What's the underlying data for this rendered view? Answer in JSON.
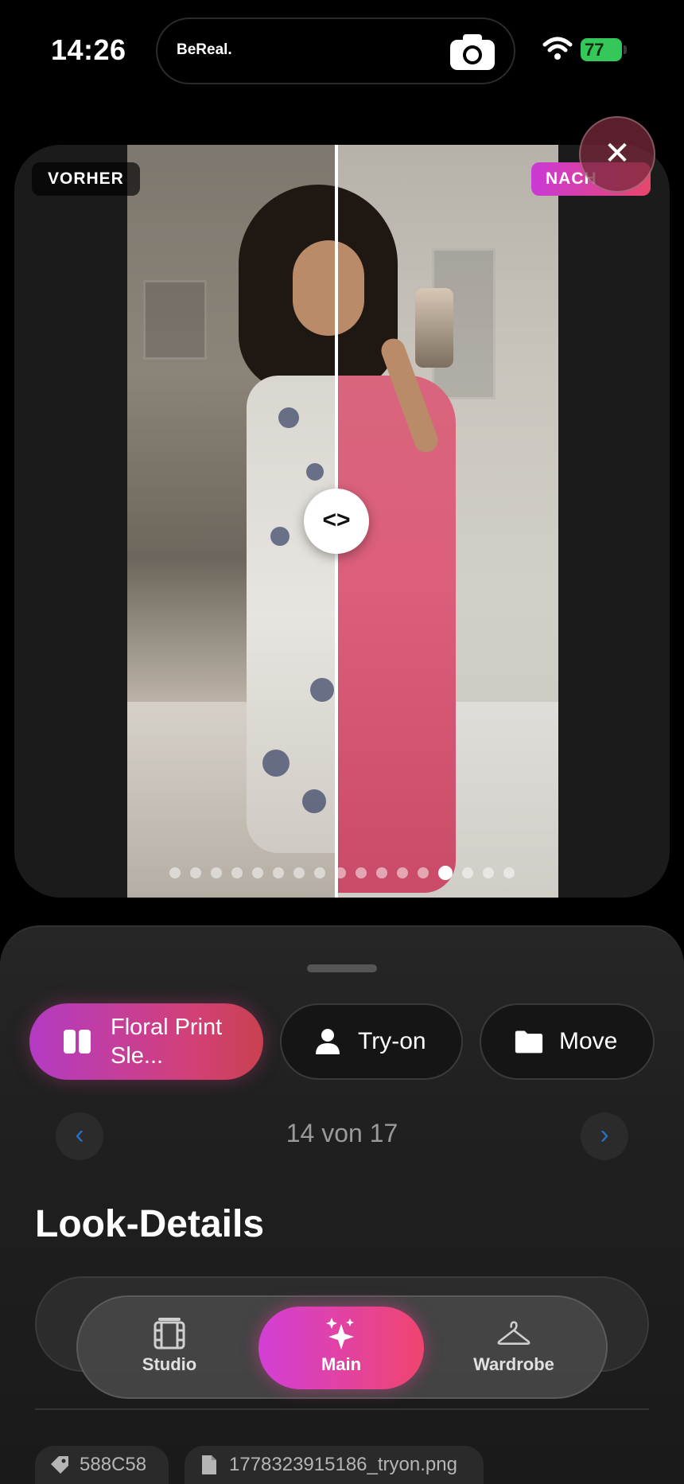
{
  "status_bar": {
    "time": "14:26",
    "island_app": "BeReal.",
    "battery": "77"
  },
  "viewer": {
    "before_label": "VORHER",
    "after_label": "NACH",
    "handle_glyph": "<>",
    "close_glyph": "✕",
    "page_dots_total": 17,
    "page_dots_active_index": 13
  },
  "sheet": {
    "actions": [
      {
        "label": "Floral Print Sle...",
        "icon": "compare-icon"
      },
      {
        "label": "Try-on",
        "icon": "person-icon"
      },
      {
        "label": "Move",
        "icon": "folder-icon"
      }
    ],
    "prev_glyph": "‹",
    "next_glyph": "›",
    "counter": "14 von 17",
    "section_title": "Look-Details"
  },
  "tabbar": {
    "tabs": [
      {
        "label": "Studio",
        "icon": "film-icon"
      },
      {
        "label": "Main",
        "icon": "sparkles-icon",
        "active": true
      },
      {
        "label": "Wardrobe",
        "icon": "hanger-icon"
      }
    ]
  },
  "meta_chips": {
    "id": "588C58",
    "file": "1778323915186_tryon.png"
  },
  "colors": {
    "accent_magenta": "#d23fd6",
    "accent_pink": "#f0456f",
    "nav_blue": "#2a6fc0",
    "battery_green": "#34c759"
  }
}
